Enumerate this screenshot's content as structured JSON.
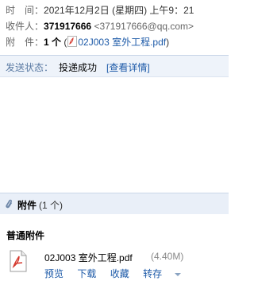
{
  "header": {
    "time_label": "时　间：",
    "time_value": "2021年12月2日 (星期四) 上午9：21",
    "recipient_label": "收件人：",
    "recipient_name": "371917666",
    "recipient_email": "<371917666@qq.com>",
    "attachment_label": "附　件：",
    "attachment_count": "1 个",
    "attachment_open": "(",
    "attachment_file": "02J003 室外工程.pdf",
    "attachment_close": ")"
  },
  "status": {
    "label": "发送状态：",
    "value": "投递成功",
    "link": "[查看详情]"
  },
  "attachments": {
    "title": "附件",
    "count": "(1 个)",
    "section_title": "普通附件",
    "file": {
      "name": "02J003 室外工程.pdf",
      "size": "(4.40M)",
      "actions": [
        "预览",
        "下载",
        "收藏",
        "转存"
      ]
    }
  },
  "icons": {
    "pdf": "pdf-file-icon",
    "clip": "paperclip-icon"
  },
  "colors": {
    "link": "#1d5aa8",
    "status_bg": "#eef3fa",
    "attach_bar_bg": "#e9eff8"
  }
}
